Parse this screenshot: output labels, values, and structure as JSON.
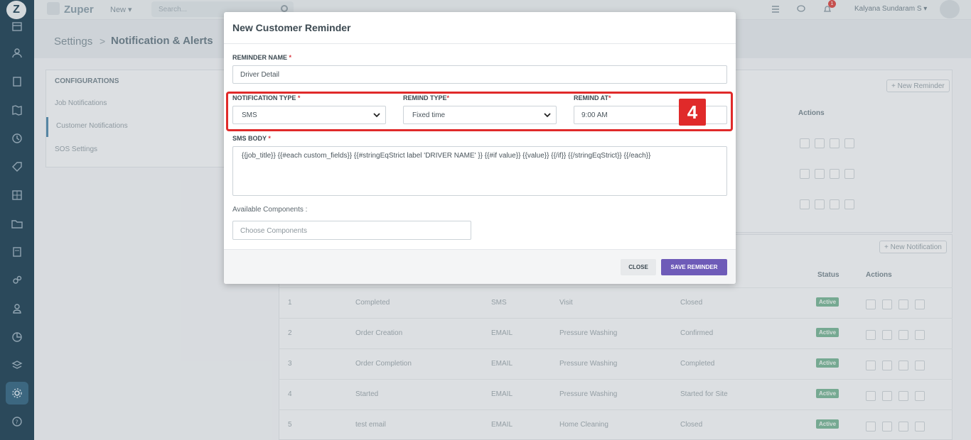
{
  "app": {
    "brand": "Zuper",
    "logo_letter": "Z",
    "new_menu_label": "New ▾",
    "search_placeholder": "Search...",
    "user_name": "Kalyana Sundaram S ▾",
    "notification_count": "1"
  },
  "sidebar": {
    "icons": [
      "calendar-icon",
      "users-icon",
      "building-icon",
      "map-icon",
      "clock-icon",
      "tag-icon",
      "table-icon",
      "folder-icon",
      "report-icon",
      "gears-icon",
      "person-icon",
      "chart-icon",
      "layers-icon",
      "settings-icon",
      "help-icon"
    ],
    "active": "settings-icon"
  },
  "breadcrumb": {
    "root": "Settings",
    "separator": ">",
    "current": "Notification & Alerts"
  },
  "configurations": {
    "title": "CONFIGURATIONS",
    "items": [
      "Job Notifications",
      "Customer Notifications",
      "SOS Settings"
    ],
    "active": "Customer Notifications"
  },
  "reminders_panel": {
    "new_button": "+ New Reminder",
    "actions_header": "Actions"
  },
  "notifications_panel": {
    "new_button": "+ New Notification",
    "status_header": "Status",
    "actions_header": "Actions",
    "rows": [
      {
        "no": "1",
        "name": "Completed",
        "channel": "SMS",
        "category": "Visit",
        "status_text": "Closed",
        "status": "Active"
      },
      {
        "no": "2",
        "name": "Order Creation",
        "channel": "EMAIL",
        "category": "Pressure Washing",
        "status_text": "Confirmed",
        "status": "Active"
      },
      {
        "no": "3",
        "name": "Order Completion",
        "channel": "EMAIL",
        "category": "Pressure Washing",
        "status_text": "Completed",
        "status": "Active"
      },
      {
        "no": "4",
        "name": "Started",
        "channel": "EMAIL",
        "category": "Pressure Washing",
        "status_text": "Started for Site",
        "status": "Active"
      },
      {
        "no": "5",
        "name": "test email",
        "channel": "EMAIL",
        "category": "Home Cleaning",
        "status_text": "Closed",
        "status": "Active"
      }
    ]
  },
  "modal": {
    "title": "New Customer Reminder",
    "reminder_name_label": "REMINDER NAME",
    "reminder_name_value": "Driver Detail",
    "notification_type_label": "NOTIFICATION TYPE",
    "notification_type_value": "SMS",
    "remind_type_label": "REMIND TYPE",
    "remind_type_value": "Fixed time",
    "remind_at_label": "REMIND AT",
    "remind_at_value": "9:00 AM",
    "sms_body_label": "SMS BODY",
    "sms_body_value": "{{job_title}} {{#each custom_fields}} {{#stringEqStrict label 'DRIVER NAME' }} {{#if value}} {{value}} {{/if}} {{/stringEqStrict}} {{/each}}",
    "available_components_label": "Available Components :",
    "components_placeholder": "Choose Components",
    "required_mark": "*",
    "close_button": "CLOSE",
    "save_button": "SAVE REMINDER"
  },
  "annotation": {
    "step_number": "4",
    "color": "#e02a2a"
  },
  "colors": {
    "primary": "#6e5bb8",
    "sidebar": "#2a4a5e",
    "active_badge": "#7fb89c"
  }
}
